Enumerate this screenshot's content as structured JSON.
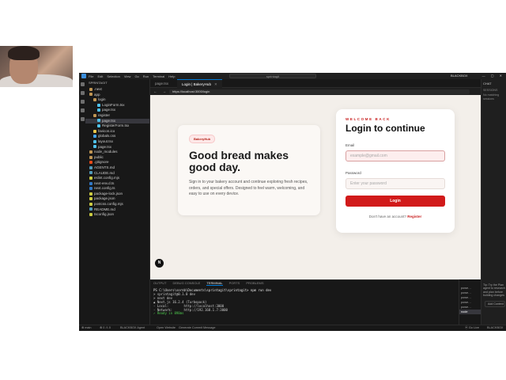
{
  "titlebar": {
    "menus": [
      "File",
      "Edit",
      "Selection",
      "View",
      "Go",
      "Run",
      "Terminal",
      "Help"
    ],
    "search": "sprintagit",
    "blackbox": "BLACKBOX"
  },
  "sidebar": {
    "header": "SPRINTAGIT",
    "items": [
      {
        "label": ".next",
        "indent": 1,
        "icon": "folder"
      },
      {
        "label": "app",
        "indent": 1,
        "icon": "folder"
      },
      {
        "label": "login",
        "indent": 2,
        "icon": "folder"
      },
      {
        "label": "LoginForm.tsx",
        "indent": 3,
        "icon": "react"
      },
      {
        "label": "page.tsx",
        "indent": 3,
        "icon": "react"
      },
      {
        "label": "register",
        "indent": 2,
        "icon": "folder"
      },
      {
        "label": "page.tsx",
        "indent": 3,
        "icon": "react",
        "selected": true
      },
      {
        "label": "RegisterForm.tsx",
        "indent": 3,
        "icon": "react"
      },
      {
        "label": "favicon.ico",
        "indent": 2,
        "icon": "star"
      },
      {
        "label": "globals.css",
        "indent": 2,
        "icon": "css"
      },
      {
        "label": "layout.tsx",
        "indent": 2,
        "icon": "react"
      },
      {
        "label": "page.tsx",
        "indent": 2,
        "icon": "react"
      },
      {
        "label": "node_modules",
        "indent": 1,
        "icon": "folder"
      },
      {
        "label": "public",
        "indent": 1,
        "icon": "folder"
      },
      {
        "label": ".gitignore",
        "indent": 1,
        "icon": "git"
      },
      {
        "label": "AGENTS.md",
        "indent": 1,
        "icon": "md"
      },
      {
        "label": "CLAUDE.md",
        "indent": 1,
        "icon": "md"
      },
      {
        "label": "eslint.config.mjs",
        "indent": 1,
        "icon": "js"
      },
      {
        "label": "next-env.d.ts",
        "indent": 1,
        "icon": "ts"
      },
      {
        "label": "next.config.ts",
        "indent": 1,
        "icon": "ts"
      },
      {
        "label": "package-lock.json",
        "indent": 1,
        "icon": "json"
      },
      {
        "label": "package.json",
        "indent": 1,
        "icon": "json"
      },
      {
        "label": "postcss.config.mjs",
        "indent": 1,
        "icon": "js"
      },
      {
        "label": "README.md",
        "indent": 1,
        "icon": "md"
      },
      {
        "label": "tsconfig.json",
        "indent": 1,
        "icon": "json"
      }
    ]
  },
  "tabs": [
    {
      "label": "page.tsx",
      "active": false
    },
    {
      "label": "Login | BakeryHub",
      "active": true
    }
  ],
  "browser": {
    "url": "https://localhost:3000/login"
  },
  "page": {
    "hero": {
      "badge": "BakeryHub",
      "title": "Good bread makes good day.",
      "description": "Sign in to your bakery account and continue exploring fresh recipes, orders, and special offers. Designed to feel warm, welcoming, and easy to use on every device."
    },
    "login": {
      "eyebrow": "WELCOME BACK",
      "title": "Login to continue",
      "email_label": "Email",
      "email_placeholder": "example@gmail.com",
      "password_label": "Password",
      "password_placeholder": "Enter your password",
      "button": "Login",
      "signup_text": "Don't have an account?",
      "signup_link": "Register"
    },
    "next_badge": "N"
  },
  "panel": {
    "tabs": [
      "OUTPUT",
      "DEBUG CONSOLE",
      "TERMINAL",
      "PORTS",
      "PROBLEMS"
    ],
    "active_tab": "TERMINAL",
    "lines": [
      "PS C:\\Users\\sornb\\Documents\\sprintagit\\sprintagit> npm run dev",
      "",
      "> sprintagit@0.1.0 dev",
      "> next dev",
      "",
      "▲ Next.js 16.2.4 (Turbopack)",
      "- Local:        http://localhost:3000",
      "- Network:      http://192.168.1.7:3000",
      "✓ Ready in 898ms"
    ],
    "terminals": [
      "powe…",
      "powe…",
      "powe…",
      "powe…",
      "powe…",
      "node"
    ]
  },
  "chat": {
    "title": "CHAT",
    "section": "SESSIONS",
    "empty": "No matching sessions",
    "tip": "Tip: Try the Plan agent to research and plan before building changes",
    "add": "Add Context"
  },
  "statusbar": {
    "left": "⊗ main",
    "errors": "⊗ 0 ⚠ 0",
    "blackbox": "BLACKBOX Agent",
    "open_website": "Open Website",
    "commit": "Generate Commit Message",
    "goLive": "⦿ Go Live",
    "right": "BLACKBOX"
  },
  "colors": {
    "accent": "#d11a1a",
    "page_bg": "#f3efea",
    "vscode_bg": "#1e1e1e"
  }
}
